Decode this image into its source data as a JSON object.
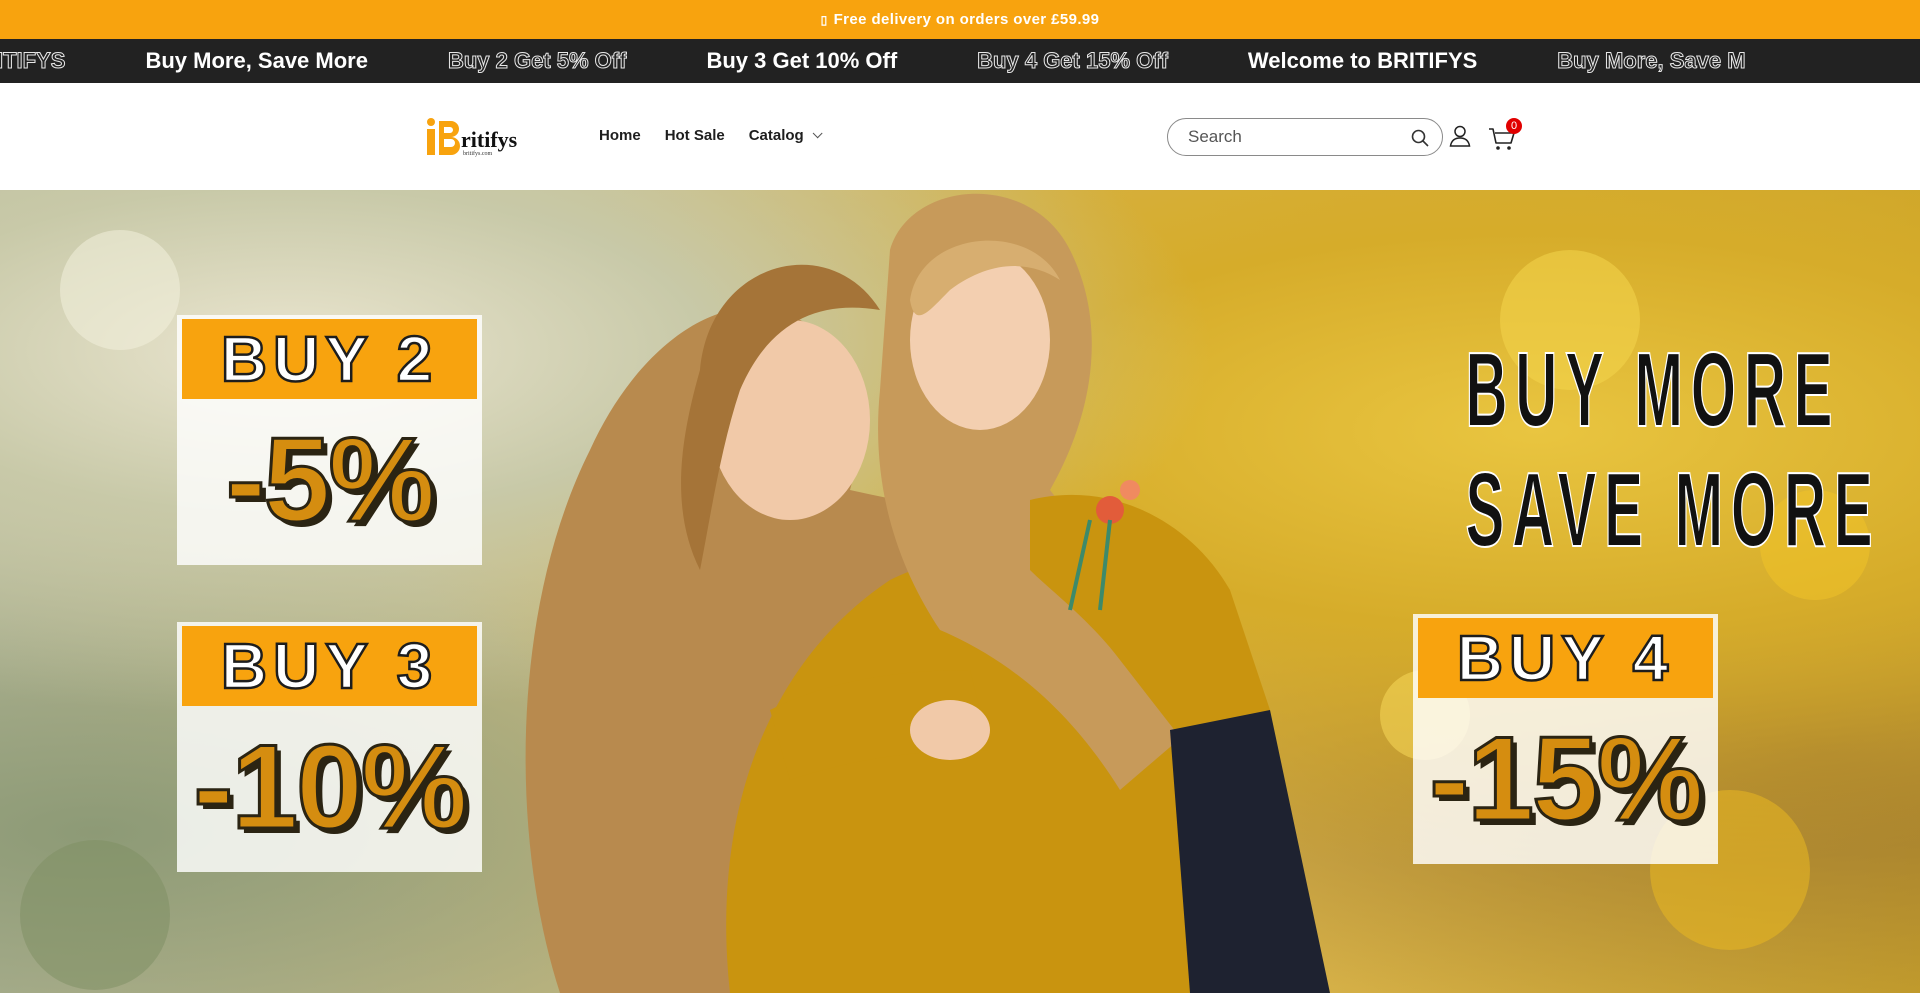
{
  "announcement": {
    "icon": "gift-icon",
    "text": "Free delivery on orders over £59.99"
  },
  "marquee": {
    "items": [
      {
        "text": "e to BRITIFYS",
        "style": "outline"
      },
      {
        "text": "Buy More, Save More",
        "style": "solid"
      },
      {
        "text": "Buy 2 Get 5% Off",
        "style": "outline"
      },
      {
        "text": "Buy 3 Get 10% Off",
        "style": "solid"
      },
      {
        "text": "Buy 4 Get 15% Off",
        "style": "outline"
      },
      {
        "text": "Welcome to BRITIFYS",
        "style": "solid"
      },
      {
        "text": "Buy More, Save M",
        "style": "outline"
      }
    ]
  },
  "header": {
    "logo_text": "ritifys",
    "logo_sub": "britifys.com",
    "nav": [
      {
        "label": "Home"
      },
      {
        "label": "Hot Sale"
      },
      {
        "label": "Catalog"
      }
    ],
    "search_placeholder": "Search",
    "cart_count": "0"
  },
  "hero": {
    "headline_line1": "BUY MORE",
    "headline_line2": "SAVE MORE",
    "promos": [
      {
        "title": "BUY 2",
        "discount": "-5%"
      },
      {
        "title": "BUY 3",
        "discount": "-10%"
      },
      {
        "title": "BUY 4",
        "discount": "-15%"
      }
    ]
  },
  "colors": {
    "accent": "#f8a30e",
    "marquee_bg": "#222222",
    "badge": "#e10000"
  }
}
